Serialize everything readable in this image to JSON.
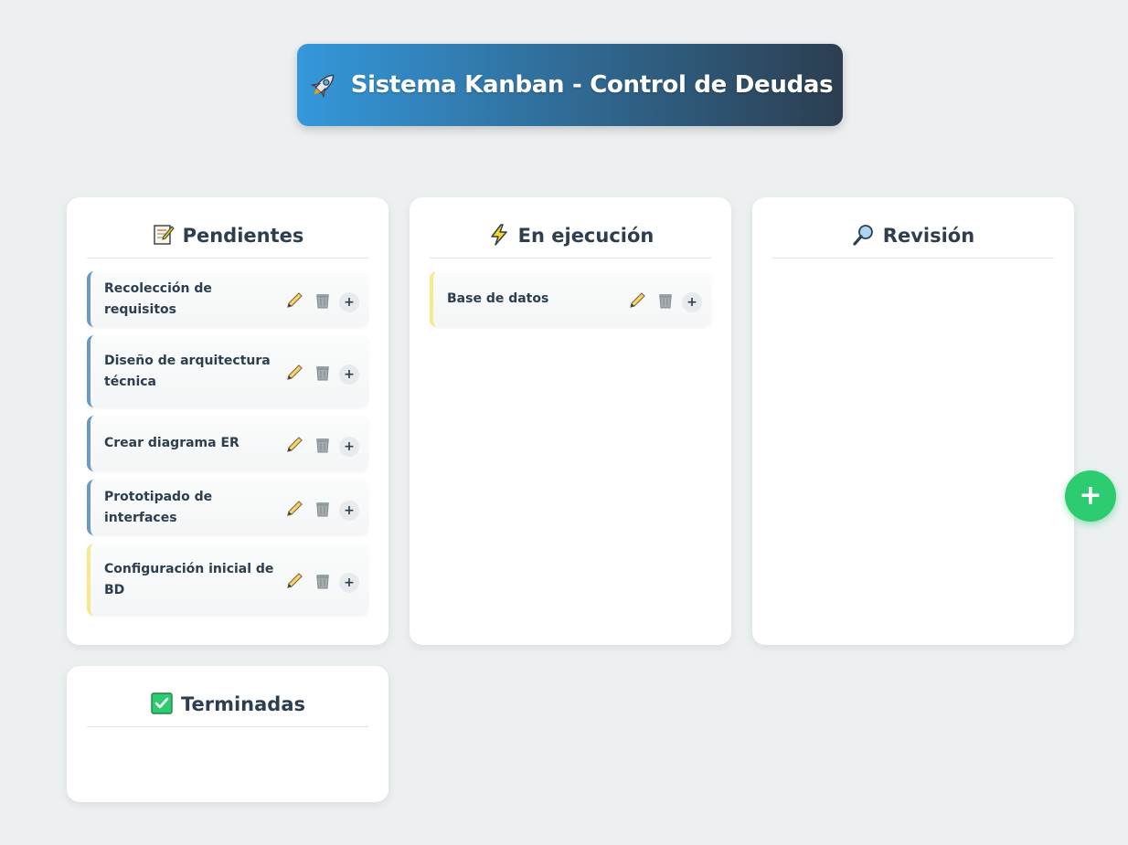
{
  "header": {
    "title": "Sistema Kanban - Control de Deudas",
    "icon": "rocket-icon"
  },
  "columns": [
    {
      "title": "Pendientes",
      "icon": "memo-icon",
      "cards": [
        {
          "text": "Recolección de requisitos",
          "accent": "#6c9ac7"
        },
        {
          "text": "Diseño de arquitectura técnica",
          "accent": "#6c9ac7"
        },
        {
          "text": "Crear diagrama ER",
          "accent": "#6c9ac7"
        },
        {
          "text": "Prototipado de interfaces",
          "accent": "#6c9ac7"
        },
        {
          "text": "Configuración inicial de BD",
          "accent": "#f7e98e"
        }
      ]
    },
    {
      "title": "En ejecución",
      "icon": "lightning-icon",
      "cards": [
        {
          "text": "Base de datos",
          "accent": "#f7e98e"
        }
      ]
    },
    {
      "title": "Revisión",
      "icon": "magnifier-icon",
      "cards": []
    },
    {
      "title": "Terminadas",
      "icon": "check-box-icon",
      "cards": []
    }
  ],
  "card_actions": {
    "plus_label": "+"
  },
  "fab": {
    "label": "+",
    "color": "#2ecc71"
  },
  "colors": {
    "background": "#ecf0f1",
    "header_gradient_start": "#3498db",
    "header_gradient_end": "#2c3e50",
    "text": "#2c3e50"
  }
}
